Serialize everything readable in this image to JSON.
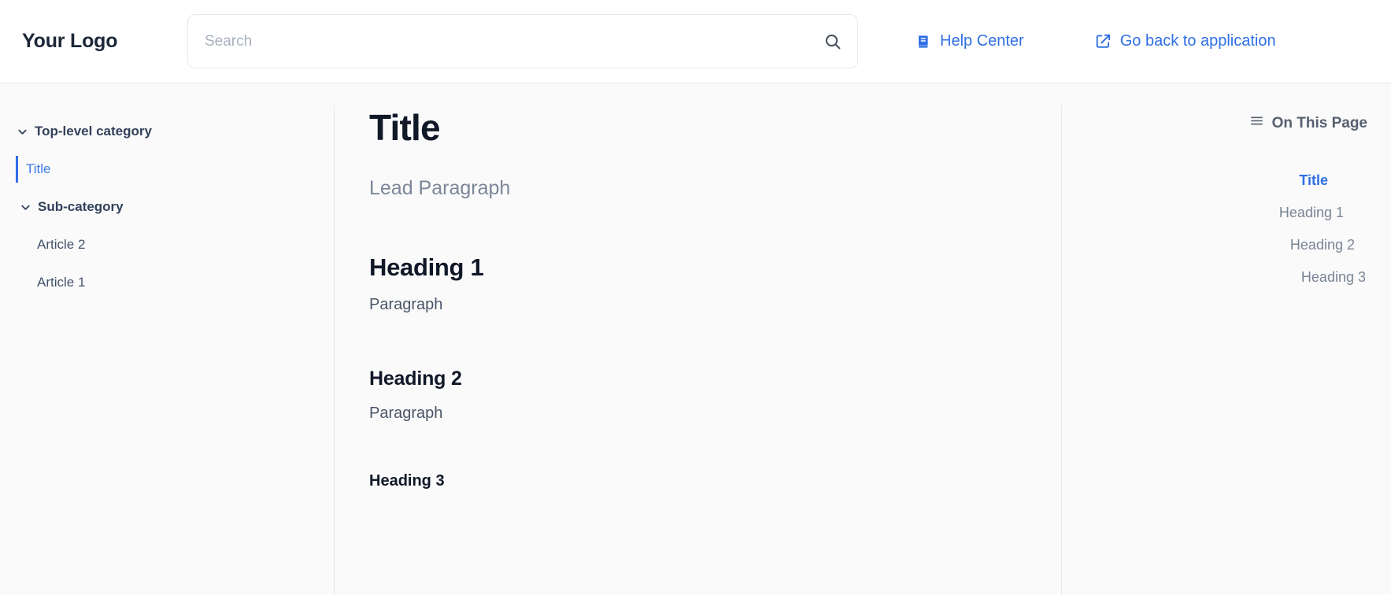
{
  "header": {
    "logo": "Your Logo",
    "search": {
      "placeholder": "Search",
      "value": "",
      "icon": "search-icon"
    },
    "links": [
      {
        "label": "Help Center",
        "icon": "book-icon"
      },
      {
        "label": "Go back to application",
        "icon": "external-link-icon"
      }
    ]
  },
  "sidebar": {
    "top_category": {
      "label": "Top-level category",
      "icon": "chevron-down-icon",
      "expanded": true
    },
    "active_article": {
      "label": "Title",
      "active": true
    },
    "sub_category": {
      "label": "Sub-category",
      "icon": "chevron-down-icon",
      "expanded": true
    },
    "articles": [
      {
        "label": "Article 2"
      },
      {
        "label": "Article 1"
      }
    ]
  },
  "article": {
    "title": "Title",
    "lead": "Lead Paragraph",
    "heading1": "Heading 1",
    "paragraph1": "Paragraph",
    "heading2": "Heading 2",
    "paragraph2": "Paragraph",
    "heading3": "Heading 3"
  },
  "on_this_page": {
    "heading": "On This Page",
    "icon": "hamburger-icon",
    "items": [
      {
        "label": "Title",
        "level": 0,
        "active": true
      },
      {
        "label": "Heading 1",
        "level": 1,
        "active": false
      },
      {
        "label": "Heading 2",
        "level": 2,
        "active": false
      },
      {
        "label": "Heading 3",
        "level": 3,
        "active": false
      }
    ]
  },
  "colors": {
    "accent": "#2f6fe4",
    "text_dark": "#101828",
    "text_muted": "#7a8595",
    "background": "#fafafa",
    "header_background": "#ffffff",
    "border": "#e4e8ef"
  }
}
